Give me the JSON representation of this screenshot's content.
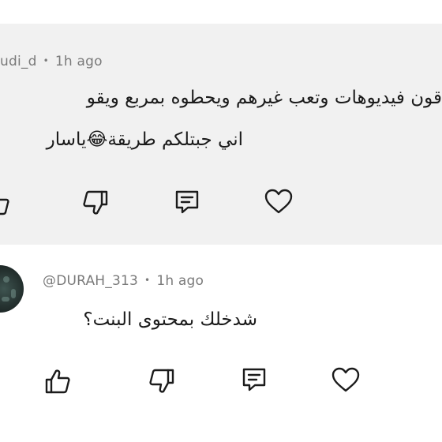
{
  "comments": [
    {
      "handle": "udi_d",
      "time": "1h ago",
      "lines": [
        "قون فيديوهات وتعب غيرهم ويحطوه بمربع ويقو",
        "اني جبتلكم طريقة😂ياسار"
      ],
      "actions": [
        "like-icon",
        "dislike-icon",
        "reply-icon",
        "heart-icon"
      ]
    },
    {
      "handle": "@DURAH_313",
      "time": "1h ago",
      "lines": [
        "شدخلك بمحتوى البنت؟"
      ],
      "actions": [
        "like-icon",
        "dislike-icon",
        "reply-icon",
        "heart-icon"
      ]
    }
  ],
  "colors": {
    "highlight_bg": "#f1f1f1",
    "meta_text": "#7a7a7a",
    "icon": "#1b1b1b"
  }
}
